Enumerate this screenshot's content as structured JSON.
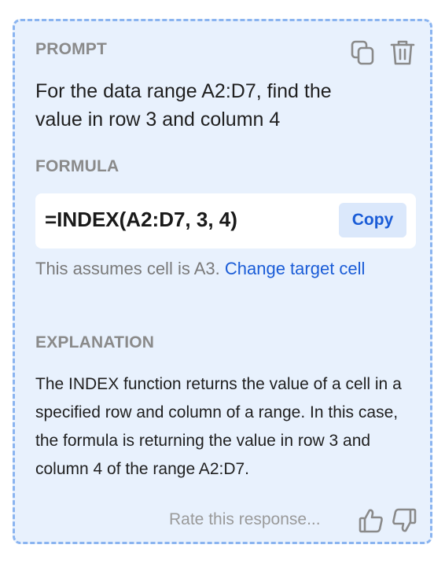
{
  "prompt": {
    "label": "PROMPT",
    "text": "For the data range A2:D7, find the value in row 3 and column 4",
    "icons": [
      "copy-icon",
      "trash-icon"
    ]
  },
  "formula": {
    "label": "FORMULA",
    "value": "=INDEX(A2:D7, 3, 4)",
    "copy_label": "Copy",
    "assumption_text": "This assumes cell is A3.",
    "change_target_label": "Change target cell"
  },
  "explanation": {
    "label": "EXPLANATION",
    "text": "The INDEX function returns the value of a cell in a specified row and column of a range. In this case, the formula is returning the value in row 3 and column 4 of the range A2:D7."
  },
  "feedback": {
    "prompt": "Rate this response...",
    "icons": [
      "thumbs-up-icon",
      "thumbs-down-icon"
    ]
  },
  "colors": {
    "card_background": "#e8f1fd",
    "card_border": "#8ab4f0",
    "accent": "#1a5cd7",
    "label_gray": "#8a8a8a"
  }
}
